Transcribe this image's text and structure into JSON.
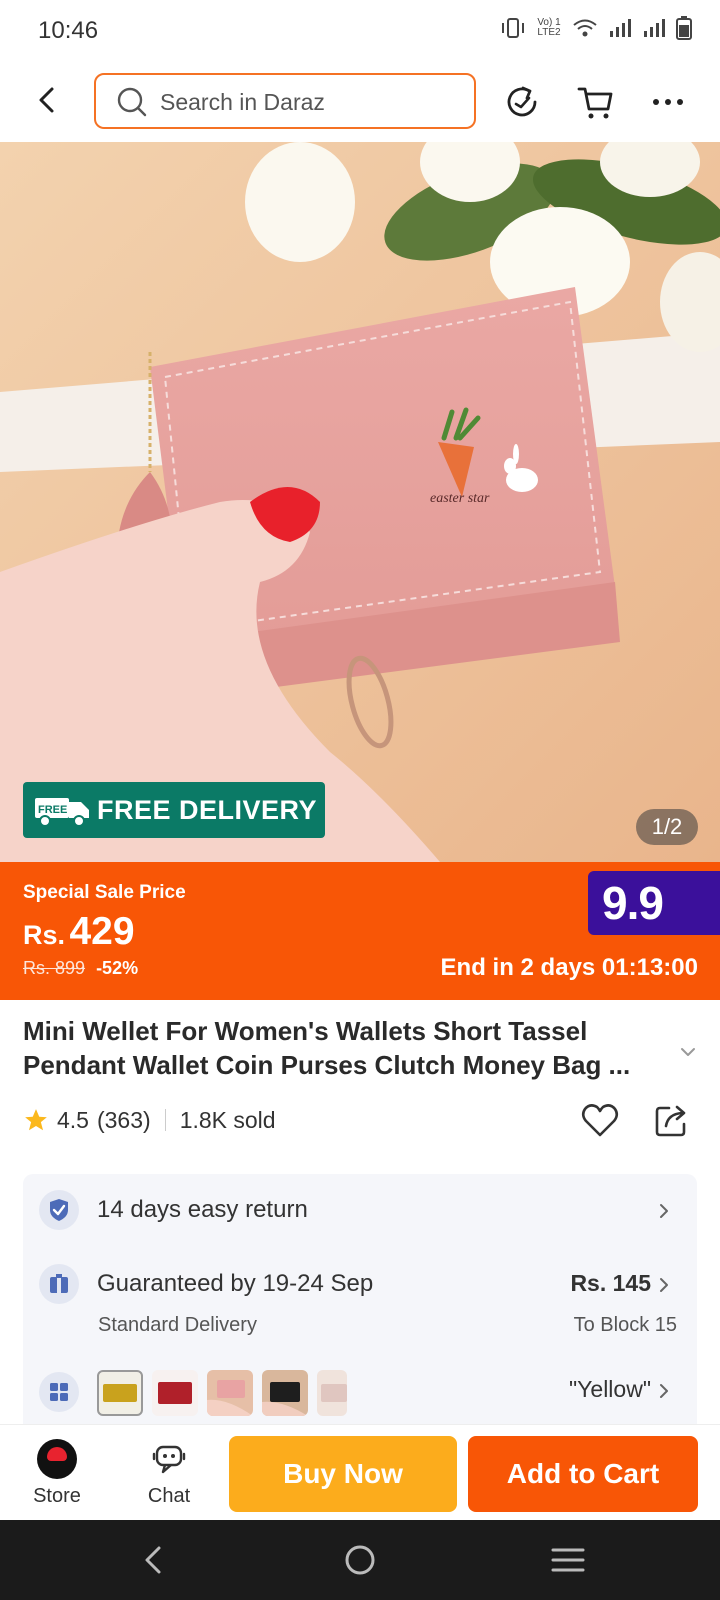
{
  "status_bar": {
    "time": "10:46",
    "network_label": "Vo) 1 LTE2"
  },
  "header": {
    "search_placeholder": "Search in Daraz"
  },
  "hero": {
    "badge_text": "FREE DELIVERY",
    "truck_label": "FREE",
    "image_counter": "1/2",
    "wallet_script": "easter star"
  },
  "price": {
    "label": "Special Sale Price",
    "currency": "Rs.",
    "value": "429",
    "old_price": "Rs. 899",
    "discount": "-52%",
    "sale_badge": "9.9",
    "countdown": "End in 2 days 01:13:00"
  },
  "product": {
    "title": "Mini Wellet For Women's Wallets Short Tassel Pendant Wallet Coin Purses Clutch Money Bag ...",
    "rating": "4.5",
    "rating_count": "(363)",
    "sold": "1.8K sold"
  },
  "info": {
    "return_text": "14 days easy return",
    "delivery_text": "Guaranteed by 19-24 Sep",
    "delivery_sub": "Standard Delivery",
    "delivery_fee": "Rs. 145",
    "delivery_location": "To Block 15",
    "variant_selected": "\"Yellow\""
  },
  "actions": {
    "store_label": "Store",
    "chat_label": "Chat",
    "buy_now": "Buy Now",
    "add_to_cart": "Add to Cart"
  },
  "colors": {
    "brand_orange": "#f85606",
    "buy_yellow": "#fcac1c",
    "free_green": "#0b7a66",
    "sale_purple": "#3b109b"
  }
}
